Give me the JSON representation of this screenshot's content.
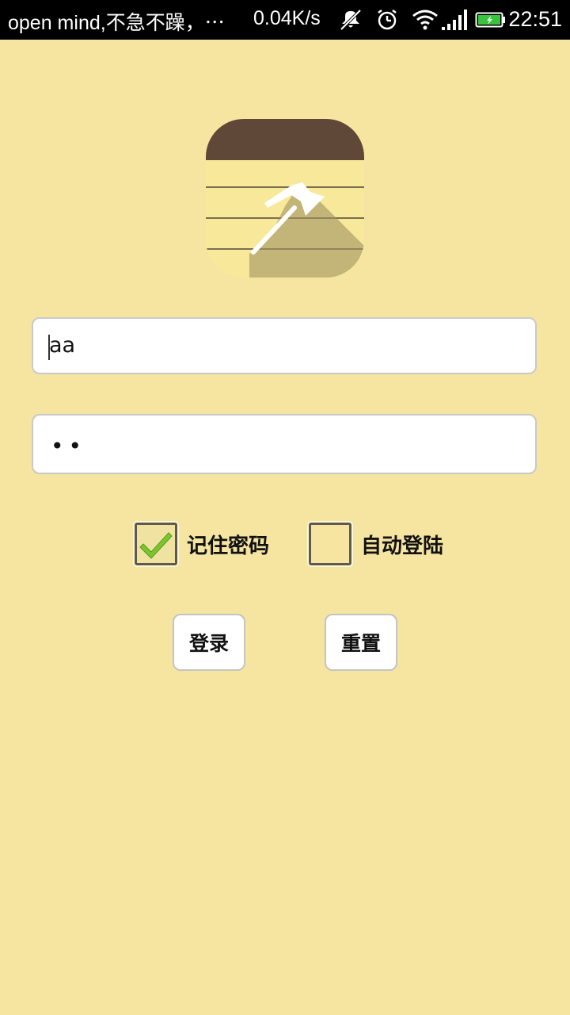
{
  "status_bar": {
    "notification": "open mind,不急不躁，⋯",
    "net_speed": "0.04K/s",
    "time": "22:51",
    "icons": [
      "mute-icon",
      "alarm-icon",
      "wifi-icon",
      "signal-icon",
      "battery-charging-icon"
    ]
  },
  "login": {
    "logo_icon": "notepad-pin-icon",
    "username_value": "aa",
    "password_mask": "••",
    "remember_label": "记住密码",
    "remember_checked": true,
    "auto_login_label": "自动登陆",
    "auto_login_checked": false,
    "login_button": "登录",
    "reset_button": "重置"
  },
  "colors": {
    "background": "#f5e5a1",
    "logo_header": "#5f4837",
    "logo_paper": "#f8e99a",
    "check_green": "#7cc62d"
  }
}
